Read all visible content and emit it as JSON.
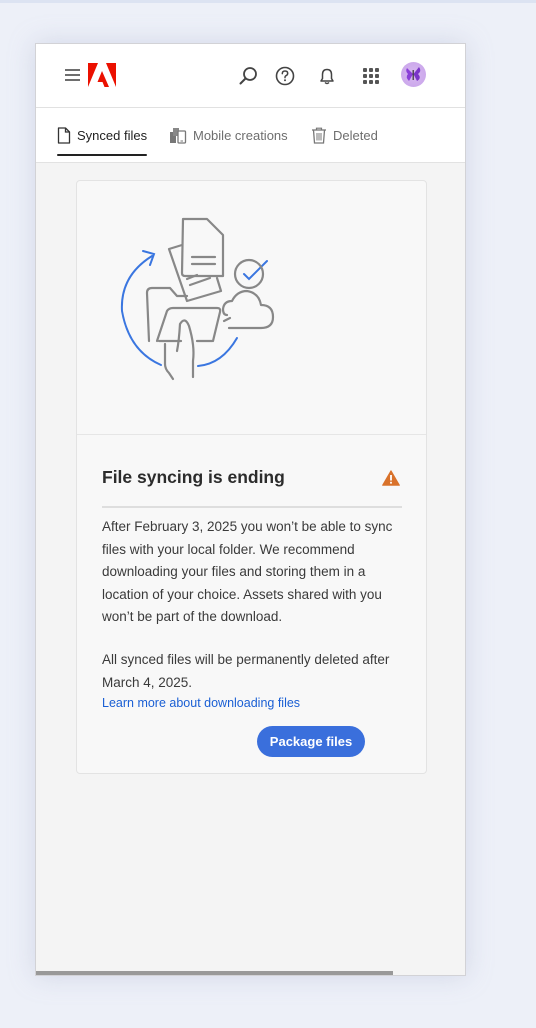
{
  "header": {
    "menu_icon": "hamburger-icon",
    "logo": "adobe-logo",
    "icons": [
      "search-icon",
      "help-icon",
      "bell-icon",
      "apps-grid-icon"
    ],
    "avatar": "user-avatar"
  },
  "tabs": [
    {
      "label": "Synced files",
      "icon": "file-icon",
      "active": true
    },
    {
      "label": "Mobile creations",
      "icon": "mobile-creations-icon",
      "active": false
    },
    {
      "label": "Deleted",
      "icon": "trash-icon",
      "active": false
    }
  ],
  "notice": {
    "title": "File syncing is ending",
    "status_icon": "warning-icon",
    "paragraph1": "After February 3, 2025 you won’t be able to sync files with your local folder. We recommend downloading your files and storing them in a location of your choice. Assets shared with you won’t be part of the download.",
    "paragraph2": "All synced files will be permanently deleted after March 4, 2025.",
    "link": "Learn more about downloading files",
    "button": "Package files"
  },
  "colors": {
    "accent": "#3a6fdc",
    "link": "#1a5fd4",
    "warning": "#d9722b",
    "brand": "#eb1000"
  }
}
